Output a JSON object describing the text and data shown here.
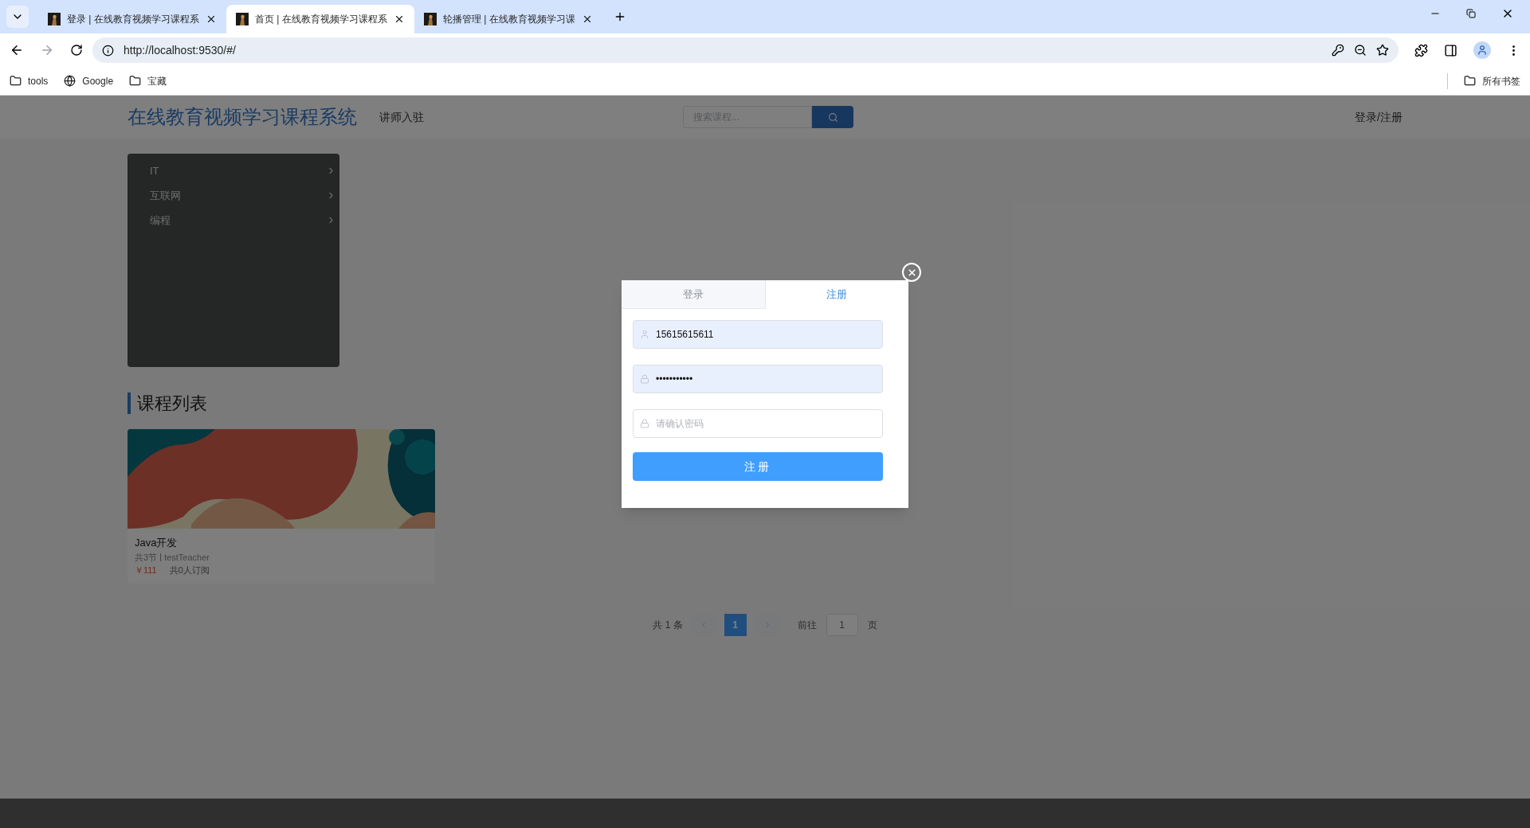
{
  "browser": {
    "tabs": [
      {
        "title": "登录 | 在线教育视频学习课程系",
        "selected": false
      },
      {
        "title": "首页 | 在线教育视频学习课程系",
        "selected": true
      },
      {
        "title": "轮播管理 | 在线教育视频学习课",
        "selected": false
      }
    ],
    "address": "http://localhost:9530/#/",
    "bookmarks": [
      {
        "kind": "folder",
        "label": "tools"
      },
      {
        "kind": "site",
        "label": "Google"
      },
      {
        "kind": "folder",
        "label": "宝藏"
      }
    ],
    "all_bookmarks": "所有书签"
  },
  "header": {
    "logo": "在线教育视频学习课程系统",
    "nav_link": "讲师入驻",
    "search_placeholder": "搜索课程...",
    "login_link": "登录/注册"
  },
  "categories": [
    {
      "label": "IT"
    },
    {
      "label": "互联网"
    },
    {
      "label": "编程"
    }
  ],
  "section_title": "课程列表",
  "courses": [
    {
      "kind": "picture",
      "title": "Java开发",
      "lessons": "共3节",
      "teacher": "testTeacher",
      "price": "￥111",
      "subscribers": "共0人订阅"
    }
  ],
  "pagination": {
    "total": "共 1 条",
    "pages": [
      {
        "label": "1",
        "selected": true
      }
    ],
    "goto_label": "前往",
    "goto_value": "1",
    "page_suffix": "页"
  },
  "dialog": {
    "tabs": [
      {
        "label": "登录",
        "selected": false
      },
      {
        "label": "注册",
        "selected": true
      }
    ],
    "fields": [
      {
        "kind": "user",
        "value": "15615615611"
      },
      {
        "kind": "lock",
        "value": "•••••••••••"
      },
      {
        "kind": "lock",
        "placeholder": "请确认密码"
      }
    ],
    "submit": "注册"
  }
}
